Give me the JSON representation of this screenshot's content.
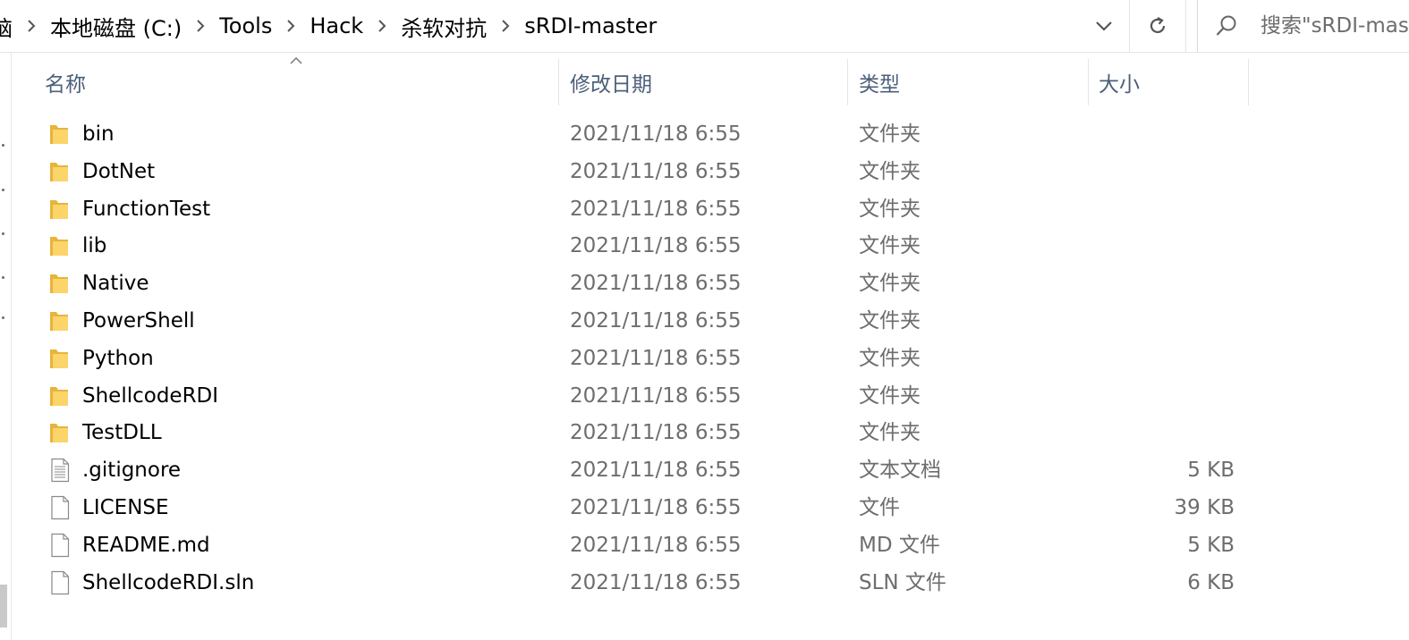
{
  "address_bar": {
    "crumbs": [
      "脑",
      "本地磁盘 (C:)",
      "Tools",
      "Hack",
      "杀软对抗",
      "sRDI-master"
    ]
  },
  "search": {
    "placeholder": "搜索\"sRDI-master\""
  },
  "columns": {
    "name": "名称",
    "date": "修改日期",
    "type": "类型",
    "size": "大小"
  },
  "files": [
    {
      "name": "bin",
      "date": "2021/11/18 6:55",
      "type": "文件夹",
      "size": "",
      "icon": "folder-icon"
    },
    {
      "name": "DotNet",
      "date": "2021/11/18 6:55",
      "type": "文件夹",
      "size": "",
      "icon": "folder-icon"
    },
    {
      "name": "FunctionTest",
      "date": "2021/11/18 6:55",
      "type": "文件夹",
      "size": "",
      "icon": "folder-icon"
    },
    {
      "name": "lib",
      "date": "2021/11/18 6:55",
      "type": "文件夹",
      "size": "",
      "icon": "folder-icon"
    },
    {
      "name": "Native",
      "date": "2021/11/18 6:55",
      "type": "文件夹",
      "size": "",
      "icon": "folder-icon"
    },
    {
      "name": "PowerShell",
      "date": "2021/11/18 6:55",
      "type": "文件夹",
      "size": "",
      "icon": "folder-icon"
    },
    {
      "name": "Python",
      "date": "2021/11/18 6:55",
      "type": "文件夹",
      "size": "",
      "icon": "folder-icon"
    },
    {
      "name": "ShellcodeRDI",
      "date": "2021/11/18 6:55",
      "type": "文件夹",
      "size": "",
      "icon": "folder-icon"
    },
    {
      "name": "TestDLL",
      "date": "2021/11/18 6:55",
      "type": "文件夹",
      "size": "",
      "icon": "folder-icon"
    },
    {
      "name": ".gitignore",
      "date": "2021/11/18 6:55",
      "type": "文本文档",
      "size": "5 KB",
      "icon": "text-file-icon"
    },
    {
      "name": "LICENSE",
      "date": "2021/11/18 6:55",
      "type": "文件",
      "size": "39 KB",
      "icon": "file-icon"
    },
    {
      "name": "README.md",
      "date": "2021/11/18 6:55",
      "type": "MD 文件",
      "size": "5 KB",
      "icon": "file-icon"
    },
    {
      "name": "ShellcodeRDI.sln",
      "date": "2021/11/18 6:55",
      "type": "SLN 文件",
      "size": "6 KB",
      "icon": "file-icon"
    }
  ],
  "colors": {
    "header_text": "#4c607a",
    "secondary_text": "#6d6d6d",
    "folder_back": "#e7b43c",
    "folder_front": "#fbd46a"
  }
}
